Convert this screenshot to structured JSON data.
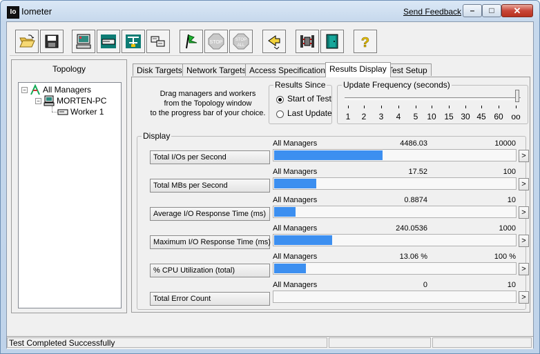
{
  "window": {
    "title": "Iometer",
    "app_icon_text": "Io",
    "feedback_link": "Send Feedback"
  },
  "window_controls": {
    "minimize": "–",
    "maximize": "□",
    "close": "✕"
  },
  "toolbar": {
    "buttons": [
      {
        "name": "open-config-button",
        "icon": "folder-open-icon"
      },
      {
        "name": "save-config-button",
        "icon": "floppy-disk-icon"
      },
      {
        "name": "start-disk-worker-button",
        "icon": "computer-icon"
      },
      {
        "name": "start-network-worker-button",
        "icon": "network-worker-icon"
      },
      {
        "name": "duplicate-worker-button",
        "icon": "duplicate-icon"
      },
      {
        "name": "disconnect-button",
        "icon": "disconnect-icon"
      },
      {
        "name": "start-test-button",
        "icon": "green-flag-icon"
      },
      {
        "name": "stop-button",
        "icon": "stop-sign-icon",
        "label": "STOP"
      },
      {
        "name": "stop-all-button",
        "icon": "stop-all-icon",
        "label": "STOP",
        "sublabel": "ALL"
      },
      {
        "name": "reset-workers-button",
        "icon": "reset-arrow-icon"
      },
      {
        "name": "new-manager-button",
        "icon": "manager-icon"
      },
      {
        "name": "exit-button",
        "icon": "exit-door-icon"
      },
      {
        "name": "about-button",
        "icon": "question-mark-icon",
        "label": "?"
      }
    ]
  },
  "topology": {
    "heading": "Topology",
    "tree": [
      {
        "label": "All Managers",
        "expander": "−"
      },
      {
        "label": "MORTEN-PC",
        "expander": "−"
      },
      {
        "label": "Worker 1"
      }
    ]
  },
  "tabs": [
    {
      "label": "Disk Targets",
      "active": false
    },
    {
      "label": "Network Targets",
      "active": false
    },
    {
      "label": "Access Specifications",
      "active": false
    },
    {
      "label": "Results Display",
      "active": true
    },
    {
      "label": "Test Setup",
      "active": false
    }
  ],
  "results": {
    "drag_text_1": "Drag managers and workers",
    "drag_text_2": "from the Topology window",
    "drag_text_3": "to the progress bar of your choice.",
    "results_since": {
      "title": "Results Since",
      "option_start": "Start of Test",
      "option_last": "Last Update",
      "selected": "Start of Test"
    },
    "update_frequency": {
      "title": "Update Frequency (seconds)",
      "ticks": [
        "1",
        "2",
        "3",
        "4",
        "5",
        "10",
        "15",
        "30",
        "45",
        "60",
        "oo"
      ],
      "selected": "oo"
    },
    "display_title": "Display",
    "metrics": [
      {
        "button": "Total I/Os per Second",
        "source": "All Managers",
        "value": "4486.03",
        "max": "10000",
        "fill": 0.4486
      },
      {
        "button": "Total MBs per Second",
        "source": "All Managers",
        "value": "17.52",
        "max": "100",
        "fill": 0.1752
      },
      {
        "button": "Average I/O Response Time (ms)",
        "source": "All Managers",
        "value": "0.8874",
        "max": "10",
        "fill": 0.0887
      },
      {
        "button": "Maximum I/O Response Time (ms)",
        "source": "All Managers",
        "value": "240.0536",
        "max": "1000",
        "fill": 0.2401
      },
      {
        "button": "% CPU Utilization (total)",
        "source": "All Managers",
        "value": "13.06 %",
        "max": "100 %",
        "fill": 0.1306
      },
      {
        "button": "Total Error Count",
        "source": "All Managers",
        "value": "0",
        "max": "10",
        "fill": 0
      }
    ],
    "more_label": ">"
  },
  "status": {
    "text": "Test Completed Successfully"
  },
  "colors": {
    "bar": "#3c8ff0",
    "close_button": "#c8473a",
    "title_gradient": "#dbe8f6"
  }
}
